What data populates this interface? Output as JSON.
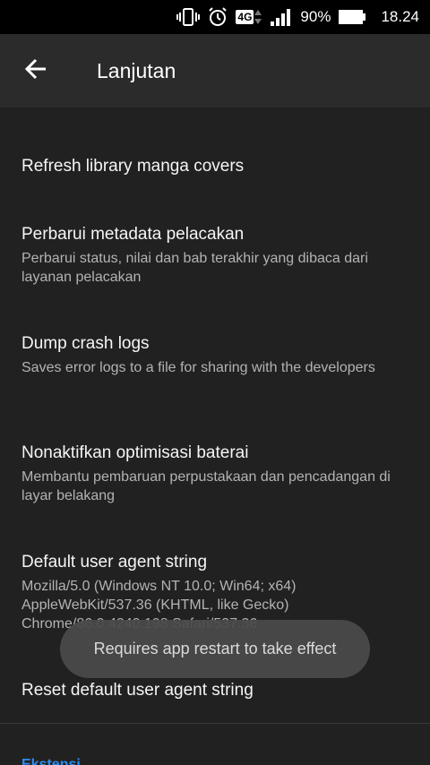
{
  "status_bar": {
    "network_type": "4G",
    "battery_percent": "90%",
    "time": "18.24"
  },
  "app_bar": {
    "title": "Lanjutan"
  },
  "preferences": [
    {
      "title": "Refresh library manga covers",
      "summary": ""
    },
    {
      "title": "Perbarui metadata pelacakan",
      "summary": "Perbarui status, nilai dan bab terakhir yang dibaca dari layanan pelacakan"
    },
    {
      "title": "Dump crash logs",
      "summary": "Saves error logs to a file for sharing with the developers"
    },
    {
      "title": "Nonaktifkan optimisasi baterai",
      "summary": "Membantu pembaruan perpustakaan dan pencadangan di layar belakang"
    },
    {
      "title": "Default user agent string",
      "summary": "Mozilla/5.0 (Windows NT 10.0; Win64; x64) AppleWebKit/537.36 (KHTML, like Gecko) Chrome/86.0.4240.198 Safari/537.36"
    },
    {
      "title": "Reset default user agent string",
      "summary": ""
    }
  ],
  "next_category": "Ekstensi",
  "toast": "Requires app restart to take effect",
  "colors": {
    "background": "#212121",
    "app_bar": "#2b2b2b",
    "accent": "#2a8cf0"
  }
}
